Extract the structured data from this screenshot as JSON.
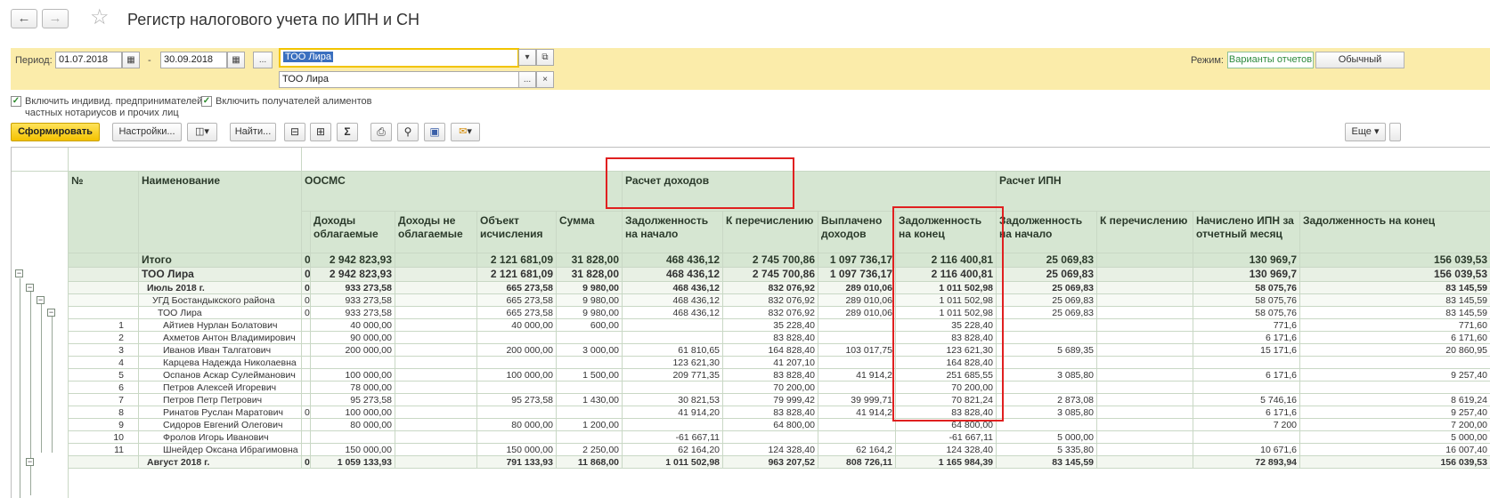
{
  "window": {
    "title": "Регистр налогового учета по ИПН и СН"
  },
  "filters": {
    "period_label": "Период:",
    "date_from": "01.07.2018",
    "dash": "-",
    "date_to": "30.09.2018",
    "ellipsis": "...",
    "org_selected": "ТОО  Лира",
    "org_field2": "ТОО  Лира",
    "mode_label": "Режим:",
    "mode_variants": "Варианты отчетов",
    "mode_normal": "Обычный"
  },
  "options": {
    "include_ip_line1": "Включить индивид. предпринимателей,",
    "include_ip_line2": "частных нотариусов и прочих лиц",
    "include_alimony": "Включить получателей алиментов"
  },
  "toolbar": {
    "generate": "Сформировать",
    "settings": "Настройки...",
    "find": "Найти...",
    "more": "Еще",
    "icons": [
      "variant-icon",
      "collapse-icon",
      "expand-icon",
      "sum-icon",
      "print-icon",
      "preview-icon",
      "save-icon",
      "mail-icon"
    ]
  },
  "table": {
    "group_headers": {
      "oosms": "ООСМС",
      "income_calc": "Расчет доходов",
      "ipn_calc": "Расчет ИПН"
    },
    "columns": {
      "no": "№",
      "name": "Наименование",
      "c1": "Доходы облагаемые",
      "c2": "Доходы не облагаемые",
      "c3": "Объект исчисления",
      "c4": "Сумма",
      "c5": "Задолженность на начало",
      "c6": "К перечислению",
      "c7": "Выплачено доходов",
      "c8": "Задолженность на конец",
      "c9": "Задолженность на начало",
      "c10": "К перечислению",
      "c11": "Начислено ИПН за отчетный месяц",
      "c12": "Задолженность на конец"
    },
    "rows": [
      {
        "no": "",
        "name": "Итого",
        "z": "0",
        "c1": "2 942 823,93",
        "c2": "",
        "c3": "2 121 681,09",
        "c4": "31 828,00",
        "c5": "468 436,12",
        "c6": "2 745 700,86",
        "c7": "1 097 736,17",
        "c8": "2 116 400,81",
        "c9": "25 069,83",
        "c10": "",
        "c11": "130 969,7",
        "c12": "156 039,53"
      },
      {
        "no": "",
        "name": "ТОО  Лира",
        "z": "0",
        "c1": "2 942 823,93",
        "c2": "",
        "c3": "2 121 681,09",
        "c4": "31 828,00",
        "c5": "468 436,12",
        "c6": "2 745 700,86",
        "c7": "1 097 736,17",
        "c8": "2 116 400,81",
        "c9": "25 069,83",
        "c10": "",
        "c11": "130 969,7",
        "c12": "156 039,53"
      },
      {
        "no": "",
        "name": "Июль 2018 г.",
        "z": "0",
        "c1": "933 273,58",
        "c2": "",
        "c3": "665 273,58",
        "c4": "9 980,00",
        "c5": "468 436,12",
        "c6": "832 076,92",
        "c7": "289 010,06",
        "c8": "1 011 502,98",
        "c9": "25 069,83",
        "c10": "",
        "c11": "58 075,76",
        "c12": "83 145,59"
      },
      {
        "no": "",
        "name": "УГД Бостандыкского района",
        "z": "0",
        "c1": "933 273,58",
        "c2": "",
        "c3": "665 273,58",
        "c4": "9 980,00",
        "c5": "468 436,12",
        "c6": "832 076,92",
        "c7": "289 010,06",
        "c8": "1 011 502,98",
        "c9": "25 069,83",
        "c10": "",
        "c11": "58 075,76",
        "c12": "83 145,59"
      },
      {
        "no": "",
        "name": "ТОО  Лира",
        "z": "0",
        "c1": "933 273,58",
        "c2": "",
        "c3": "665 273,58",
        "c4": "9 980,00",
        "c5": "468 436,12",
        "c6": "832 076,92",
        "c7": "289 010,06",
        "c8": "1 011 502,98",
        "c9": "25 069,83",
        "c10": "",
        "c11": "58 075,76",
        "c12": "83 145,59"
      },
      {
        "no": "1",
        "name": "Айтиев Нурлан Болатович",
        "z": "",
        "c1": "40 000,00",
        "c2": "",
        "c3": "40 000,00",
        "c4": "600,00",
        "c5": "",
        "c6": "35 228,40",
        "c7": "",
        "c8": "35 228,40",
        "c9": "",
        "c10": "",
        "c11": "771,6",
        "c12": "771,60"
      },
      {
        "no": "2",
        "name": "Ахметов Антон Владимирович",
        "z": "",
        "c1": "90 000,00",
        "c2": "",
        "c3": "",
        "c4": "",
        "c5": "",
        "c6": "83 828,40",
        "c7": "",
        "c8": "83 828,40",
        "c9": "",
        "c10": "",
        "c11": "6 171,6",
        "c12": "6 171,60"
      },
      {
        "no": "3",
        "name": "Иванов Иван Талгатович",
        "z": "",
        "c1": "200 000,00",
        "c2": "",
        "c3": "200 000,00",
        "c4": "3 000,00",
        "c5": "61 810,65",
        "c6": "164 828,40",
        "c7": "103 017,75",
        "c8": "123 621,30",
        "c9": "5 689,35",
        "c10": "",
        "c11": "15 171,6",
        "c12": "20 860,95"
      },
      {
        "no": "4",
        "name": "Карцева Надежда Николаевна",
        "z": "",
        "c1": "",
        "c2": "",
        "c3": "",
        "c4": "",
        "c5": "123 621,30",
        "c6": "41 207,10",
        "c7": "",
        "c8": "164 828,40",
        "c9": "",
        "c10": "",
        "c11": "",
        "c12": ""
      },
      {
        "no": "5",
        "name": "Оспанов Аскар Сулейманович",
        "z": "",
        "c1": "100 000,00",
        "c2": "",
        "c3": "100 000,00",
        "c4": "1 500,00",
        "c5": "209 771,35",
        "c6": "83 828,40",
        "c7": "41 914,2",
        "c8": "251 685,55",
        "c9": "3 085,80",
        "c10": "",
        "c11": "6 171,6",
        "c12": "9 257,40"
      },
      {
        "no": "6",
        "name": "Петров Алексей Игоревич",
        "z": "",
        "c1": "78 000,00",
        "c2": "",
        "c3": "",
        "c4": "",
        "c5": "",
        "c6": "70 200,00",
        "c7": "",
        "c8": "70 200,00",
        "c9": "",
        "c10": "",
        "c11": "",
        "c12": ""
      },
      {
        "no": "7",
        "name": "Петров Петр Петрович",
        "z": "",
        "c1": "95 273,58",
        "c2": "",
        "c3": "95 273,58",
        "c4": "1 430,00",
        "c5": "30 821,53",
        "c6": "79 999,42",
        "c7": "39 999,71",
        "c8": "70 821,24",
        "c9": "2 873,08",
        "c10": "",
        "c11": "5 746,16",
        "c12": "8 619,24"
      },
      {
        "no": "8",
        "name": "Ринатов Руслан Маратович",
        "z": "0",
        "c1": "100 000,00",
        "c2": "",
        "c3": "",
        "c4": "",
        "c5": "41 914,20",
        "c6": "83 828,40",
        "c7": "41 914,2",
        "c8": "83 828,40",
        "c9": "3 085,80",
        "c10": "",
        "c11": "6 171,6",
        "c12": "9 257,40"
      },
      {
        "no": "9",
        "name": "Сидоров Евгений Олегович",
        "z": "",
        "c1": "80 000,00",
        "c2": "",
        "c3": "80 000,00",
        "c4": "1 200,00",
        "c5": "",
        "c6": "64 800,00",
        "c7": "",
        "c8": "64 800,00",
        "c9": "",
        "c10": "",
        "c11": "7 200",
        "c12": "7 200,00"
      },
      {
        "no": "10",
        "name": "Фролов Игорь Иванович",
        "z": "",
        "c1": "",
        "c2": "",
        "c3": "",
        "c4": "",
        "c5": "-61 667,11",
        "c6": "",
        "c7": "",
        "c8": "-61 667,11",
        "c9": "5 000,00",
        "c10": "",
        "c11": "",
        "c12": "5 000,00"
      },
      {
        "no": "11",
        "name": "Шнейдер Оксана Ибрагимовна",
        "z": "",
        "c1": "150 000,00",
        "c2": "",
        "c3": "150 000,00",
        "c4": "2 250,00",
        "c5": "62 164,20",
        "c6": "124 328,40",
        "c7": "62 164,2",
        "c8": "124 328,40",
        "c9": "5 335,80",
        "c10": "",
        "c11": "10 671,6",
        "c12": "16 007,40"
      },
      {
        "no": "",
        "name": "Август 2018 г.",
        "z": "0",
        "c1": "1 059 133,93",
        "c2": "",
        "c3": "791 133,93",
        "c4": "11 868,00",
        "c5": "1 011 502,98",
        "c6": "963 207,52",
        "c7": "808 726,11",
        "c8": "1 165 984,39",
        "c9": "83 145,59",
        "c10": "",
        "c11": "72 893,94",
        "c12": "156 039,53"
      }
    ]
  }
}
